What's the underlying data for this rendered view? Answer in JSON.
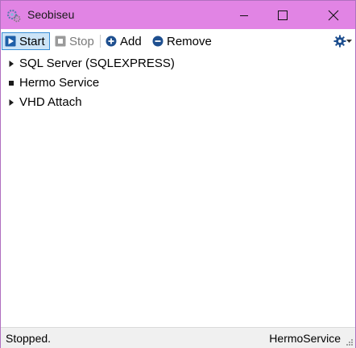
{
  "window": {
    "title": "Seobiseu",
    "accent": "#e184e4"
  },
  "toolbar": {
    "start_label": "Start",
    "stop_label": "Stop",
    "add_label": "Add",
    "remove_label": "Remove",
    "icons": {
      "start": "play-icon",
      "stop": "stop-icon",
      "add": "plus-circle-icon",
      "remove": "minus-circle-icon",
      "settings": "gear-icon"
    }
  },
  "services": [
    {
      "label": "SQL Server (SQLEXPRESS)",
      "marker": "triangle"
    },
    {
      "label": "Hermo Service",
      "marker": "square"
    },
    {
      "label": "VHD Attach",
      "marker": "triangle"
    }
  ],
  "status": {
    "left": "Stopped.",
    "right": "HermoService"
  }
}
